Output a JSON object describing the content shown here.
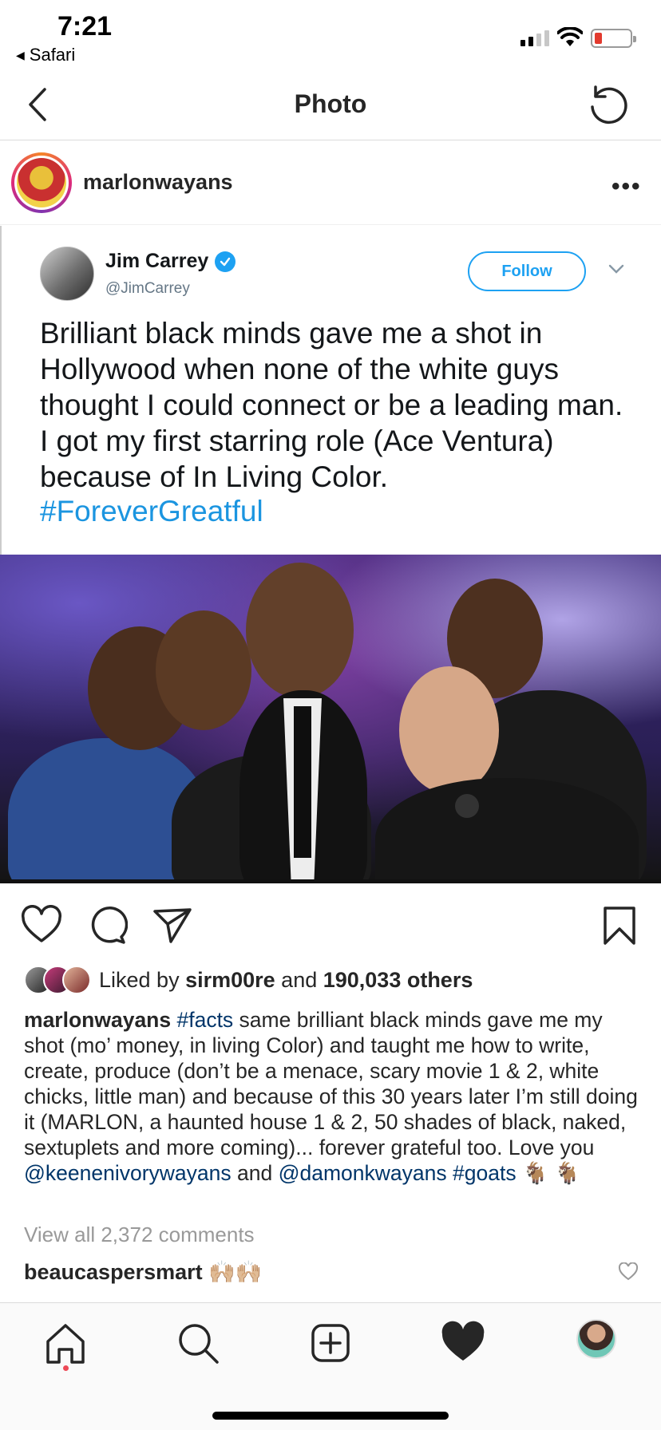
{
  "status_bar": {
    "time": "7:21",
    "back_app": "Safari"
  },
  "nav": {
    "title": "Photo"
  },
  "post": {
    "username": "marlonwayans",
    "tweet": {
      "name": "Jim Carrey",
      "handle": "@JimCarrey",
      "follow_label": "Follow",
      "text": "Brilliant black minds gave me a shot in Hollywood when none of the white guys thought I could connect or be a leading man. I got my first starring role (Ace Ventura) because of In Living Color.",
      "hashtag": "#ForeverGreatful"
    },
    "likes": {
      "prefix": "Liked by ",
      "user": "sirm00re",
      "middle": " and ",
      "count": "190,033 others"
    },
    "caption": {
      "user": "marlonwayans",
      "tag1": "#facts",
      "body": " same brilliant black minds gave me my shot (mo’ money, in living Color) and taught  me how to write, create, produce (don’t be a menace, scary movie 1 & 2, white chicks, little man) and because of this 30 years later I’m still doing it (MARLON, a haunted house 1 & 2, 50 shades of black, naked, sextuplets and more coming)... forever grateful too. Love you ",
      "mention1": "@keenenivorywayans",
      "and": " and ",
      "mention2": "@damonkwayans",
      "tag2": "#goats",
      "emoji": " 🐐 🐐"
    },
    "view_comments": "View all 2,372 comments",
    "comment": {
      "user": "beaucaspersmart",
      "emoji": "🙌🏼🙌🏼"
    }
  }
}
